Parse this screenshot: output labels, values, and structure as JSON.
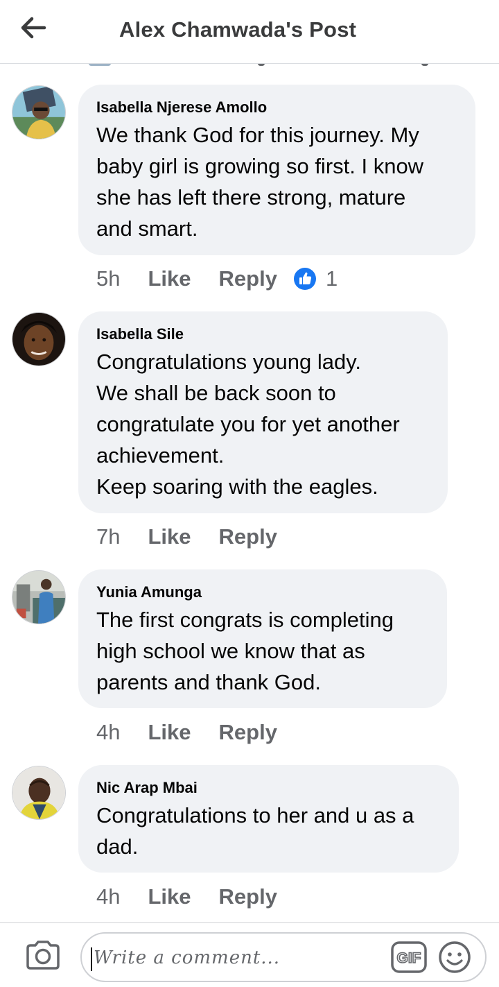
{
  "header": {
    "title": "Alex Chamwada's Post",
    "back_icon": "arrow-left-icon"
  },
  "comments": [
    {
      "author": "Isabella Njerese Amollo",
      "text": "We thank God for this journey.  My\nbaby girl is growing so first. I know\nshe has left there strong, mature\nand smart.",
      "time": "5h",
      "like_label": "Like",
      "reply_label": "Reply",
      "reaction": {
        "icon": "thumbs-up-icon",
        "count": "1",
        "color": "#1877f2"
      }
    },
    {
      "author": "Isabella Sile",
      "text": "Congratulations young lady.\nWe shall be back soon to\ncongratulate you for yet another\nachievement.\nKeep soaring with the eagles.",
      "time": "7h",
      "like_label": "Like",
      "reply_label": "Reply"
    },
    {
      "author": "Yunia Amunga",
      "text": "The first congrats is completing\nhigh school we know that as\nparents and thank God.",
      "time": "4h",
      "like_label": "Like",
      "reply_label": "Reply"
    },
    {
      "author": "Nic Arap Mbai",
      "text": "Congratulations to her and u as a\ndad.",
      "time": "4h",
      "like_label": "Like",
      "reply_label": "Reply"
    }
  ],
  "composer": {
    "placeholder": "Write a comment...",
    "camera_icon": "camera-icon",
    "gif_label": "GIF",
    "emoji_icon": "smiley-icon"
  },
  "colors": {
    "bubble_bg": "#f0f2f5",
    "meta_text": "#65676b",
    "like_blue": "#1877f2"
  }
}
